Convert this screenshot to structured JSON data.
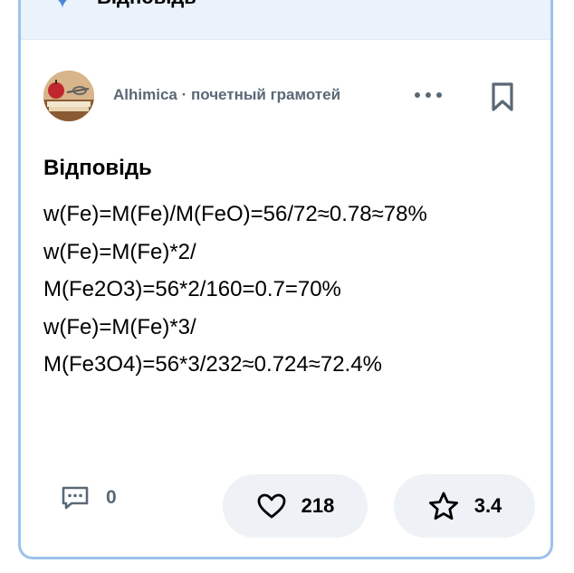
{
  "header": {
    "title": "Відповідь",
    "icon": "pin-icon",
    "corner_icon": "badge-icon",
    "accent_color": "#5a8fd9"
  },
  "author": {
    "name": "Alhimica · почетный грамотей",
    "avatar": "avatar"
  },
  "answer": {
    "heading": "Відповідь",
    "lines": [
      "w(Fe)=M(Fe)/M(FeO)=56/72≈0.78≈78%",
      "w(Fe)=M(Fe)*2/",
      "M(Fe2O3)=56*2/160=0.7=70%",
      "w(Fe)=M(Fe)*3/",
      "M(Fe3O4)=56*3/232≈0.724≈72.4%"
    ]
  },
  "footer": {
    "comments_count": "0",
    "likes_count": "218",
    "rating": "3.4"
  },
  "colors": {
    "card_border": "#9dc2ec",
    "top_bar_bg": "#eaf3fc",
    "muted_text": "#5a6876",
    "pill_bg": "#eef2f6"
  }
}
